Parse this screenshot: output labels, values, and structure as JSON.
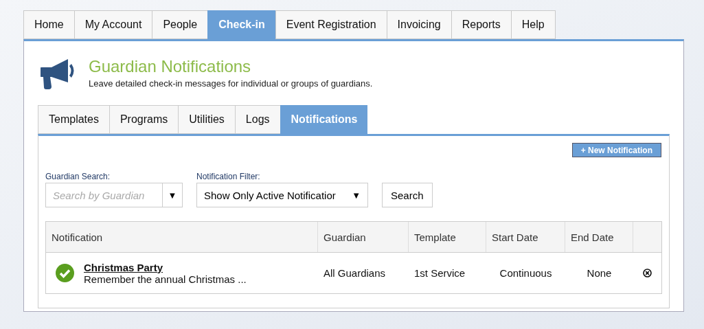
{
  "nav_tabs": [
    {
      "label": "Home",
      "selected": false
    },
    {
      "label": "My Account",
      "selected": false
    },
    {
      "label": "People",
      "selected": false
    },
    {
      "label": "Check-in",
      "selected": true
    },
    {
      "label": "Event Registration",
      "selected": false
    },
    {
      "label": "Invoicing",
      "selected": false
    },
    {
      "label": "Reports",
      "selected": false
    },
    {
      "label": "Help",
      "selected": false
    }
  ],
  "header": {
    "title": "Guardian Notifications",
    "subtitle": "Leave detailed check-in messages for individual or groups of guardians."
  },
  "sub_tabs": [
    {
      "label": "Templates",
      "selected": false
    },
    {
      "label": "Programs",
      "selected": false
    },
    {
      "label": "Utilities",
      "selected": false
    },
    {
      "label": "Logs",
      "selected": false
    },
    {
      "label": "Notifications",
      "selected": true
    }
  ],
  "new_button": {
    "icon": "+",
    "label": "New Notification"
  },
  "guardian_search": {
    "label": "Guardian Search:",
    "placeholder": "Search by Guardian",
    "arrow": "▼"
  },
  "notification_filter": {
    "label": "Notification Filter:",
    "value": "Show Only Active Notificatior",
    "arrow": "▼"
  },
  "search_button": "Search",
  "table": {
    "columns": [
      "Notification",
      "Guardian",
      "Template",
      "Start Date",
      "End Date"
    ],
    "rows": [
      {
        "active": true,
        "title": "Christmas Party",
        "message": "Remember the annual Christmas ...",
        "guardian": "All Guardians",
        "template": "1st Service",
        "start_date": "Continuous",
        "end_date": "None"
      }
    ]
  }
}
